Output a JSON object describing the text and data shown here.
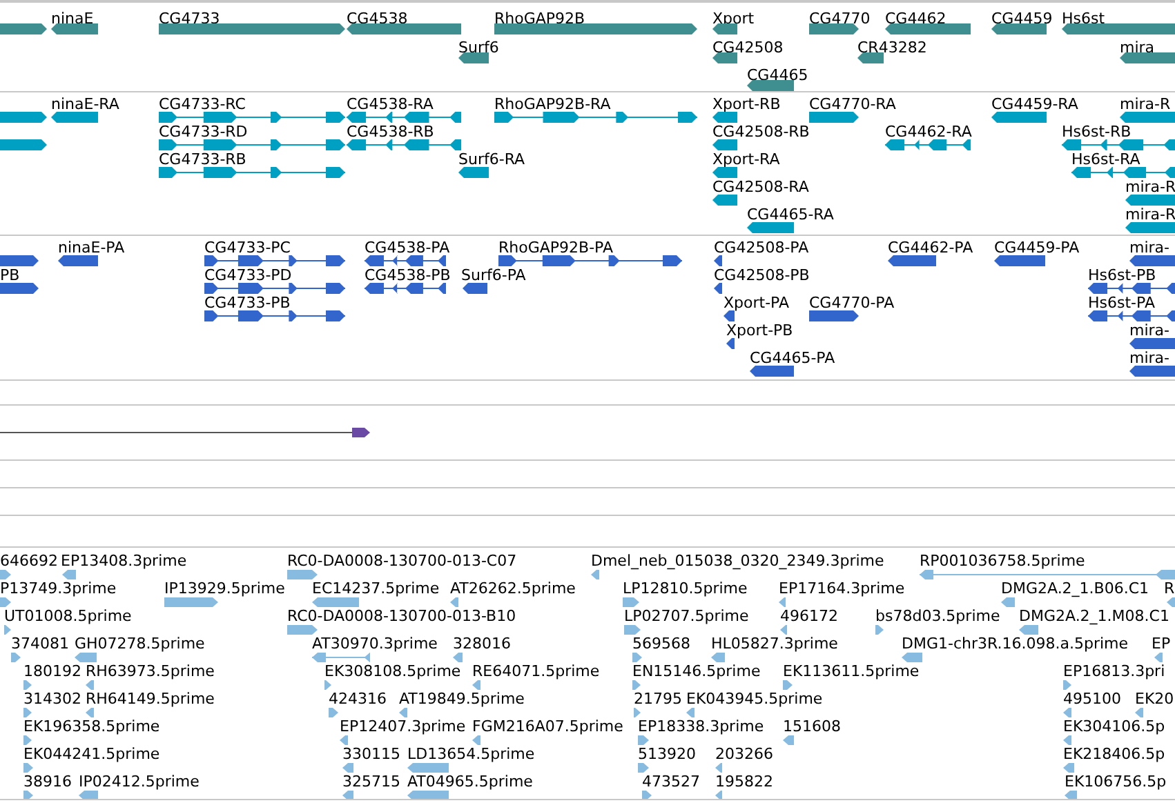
{
  "tracks": [
    {
      "kind": "gene",
      "features": [
        {
          "reverse": false
        },
        {
          "label": "ninaE",
          "reverse": true
        },
        {
          "label": "CG4733",
          "reverse": false
        },
        {
          "label": "CG4538",
          "reverse": true
        },
        {
          "label": "RhoGAP92B",
          "reverse": false
        },
        {
          "label": "Xport",
          "reverse": true
        },
        {
          "label": "CG4770",
          "reverse": false
        },
        {
          "label": "CG4462",
          "reverse": true
        },
        {
          "label": "CG4459",
          "reverse": true
        },
        {
          "label": "Hs6st",
          "reverse": true
        },
        {
          "label": "Surf6",
          "reverse": true
        },
        {
          "label": "CG42508",
          "reverse": true
        },
        {
          "label": "CR43282",
          "reverse": true
        },
        {
          "label": "mira",
          "reverse": true
        },
        {
          "label": "CG4465",
          "reverse": true
        }
      ]
    },
    {
      "kind": "transcript",
      "features": [
        {
          "reverse": false
        },
        {
          "label": "ninaE-RA",
          "reverse": true
        },
        {
          "label": "CG4733-RC",
          "reverse": false
        },
        {
          "label": "CG4538-RA",
          "reverse": true
        },
        {
          "label": "RhoGAP92B-RA",
          "reverse": false
        },
        {
          "label": "Xport-RB",
          "reverse": true
        },
        {
          "label": "CG4770-RA",
          "reverse": false
        },
        {
          "label": "CG4459-RA",
          "reverse": true
        },
        {
          "label": "mira-R",
          "reverse": true
        },
        {
          "reverse": false
        },
        {
          "label": "CG4733-RD",
          "reverse": false
        },
        {
          "label": "CG4538-RB",
          "reverse": true
        },
        {
          "label": "CG42508-RB",
          "reverse": true
        },
        {
          "label": "CG4462-RA",
          "reverse": true
        },
        {
          "label": "Hs6st-RB",
          "reverse": true
        },
        {
          "label": "CG4733-RB",
          "reverse": false
        },
        {
          "label": "Surf6-RA",
          "reverse": true
        },
        {
          "label": "Xport-RA",
          "reverse": true
        },
        {
          "label": "Hs6st-RA",
          "reverse": true
        },
        {
          "label": "CG42508-RA",
          "reverse": true
        },
        {
          "label": "mira-R",
          "reverse": true
        },
        {
          "label": "CG4465-RA",
          "reverse": true
        },
        {
          "label": "mira-R",
          "reverse": true
        }
      ]
    },
    {
      "kind": "protein",
      "features": [
        {
          "reverse": false
        },
        {
          "label": "ninaE-PA",
          "reverse": true
        },
        {
          "label": "CG4733-PC",
          "reverse": false
        },
        {
          "label": "CG4538-PA",
          "reverse": true
        },
        {
          "label": "RhoGAP92B-PA",
          "reverse": false
        },
        {
          "label": "CG42508-PA",
          "reverse": true
        },
        {
          "label": "CG4462-PA",
          "reverse": true
        },
        {
          "label": "CG4459-PA",
          "reverse": true
        },
        {
          "label": "mira-",
          "reverse": true
        },
        {
          "label": "PB",
          "reverse": false
        },
        {
          "label": "CG4733-PD",
          "reverse": false
        },
        {
          "label": "CG4538-PB",
          "reverse": true
        },
        {
          "label": "Surf6-PA",
          "reverse": true
        },
        {
          "label": "CG42508-PB",
          "reverse": true
        },
        {
          "label": "Hs6st-PB",
          "reverse": true
        },
        {
          "label": "CG4733-PB",
          "reverse": false
        },
        {
          "label": "Xport-PA",
          "reverse": true
        },
        {
          "label": "CG4770-PA",
          "reverse": false
        },
        {
          "label": "Hs6st-PA",
          "reverse": true
        },
        {
          "label": "Xport-PB",
          "reverse": true
        },
        {
          "label": "mira-",
          "reverse": true
        },
        {
          "label": "CG4465-PA",
          "reverse": true
        },
        {
          "label": "mira-",
          "reverse": true
        }
      ]
    },
    {
      "kind": "empty"
    },
    {
      "kind": "evidence",
      "features": [
        {
          "reverse": false
        }
      ]
    },
    {
      "kind": "empty"
    },
    {
      "kind": "empty"
    },
    {
      "kind": "empty"
    },
    {
      "kind": "est",
      "features": [
        {
          "label": "646692",
          "reverse": false
        },
        {
          "label": "EP13408.3prime",
          "reverse": true
        },
        {
          "label": "RC0-DA0008-130700-013-C07",
          "reverse": false
        },
        {
          "label": "Dmel_neb_015038_0320_2349.3prime",
          "reverse": true
        },
        {
          "label": "RP001036758.5prime",
          "reverse": true
        },
        {
          "label": "P13749.3prime",
          "reverse": false
        },
        {
          "label": "IP13929.5prime",
          "reverse": false
        },
        {
          "label": "EC14237.5prime",
          "reverse": true
        },
        {
          "label": "AT26262.5prime",
          "reverse": true
        },
        {
          "label": "LP12810.5prime",
          "reverse": false
        },
        {
          "label": "EP17164.3prime",
          "reverse": true
        },
        {
          "label": "DMG2A.2_1.B06.C1",
          "reverse": true
        },
        {
          "label": "R",
          "reverse": true
        },
        {
          "label": "UT01008.5prime",
          "reverse": false
        },
        {
          "label": "RC0-DA0008-130700-013-B10",
          "reverse": false
        },
        {
          "label": "LP02707.5prime",
          "reverse": false
        },
        {
          "label": "496172",
          "reverse": true
        },
        {
          "label": "bs78d03.5prime",
          "reverse": false
        },
        {
          "label": "DMG2A.2_1.M08.C1",
          "reverse": true
        },
        {
          "label": "374081",
          "reverse": false
        },
        {
          "label": "GH07278.5prime",
          "reverse": true
        },
        {
          "label": "AT30970.3prime",
          "reverse": true
        },
        {
          "label": "328016",
          "reverse": true
        },
        {
          "label": "569568",
          "reverse": false
        },
        {
          "label": "HL05827.3prime",
          "reverse": true
        },
        {
          "label": "DMG1-chr3R.16.098.a.5prime",
          "reverse": true
        },
        {
          "label": "EP",
          "reverse": true
        },
        {
          "label": "180192",
          "reverse": false
        },
        {
          "label": "RH63973.5prime",
          "reverse": true
        },
        {
          "label": "EK308108.5prime",
          "reverse": false
        },
        {
          "label": "RE64071.5prime",
          "reverse": true
        },
        {
          "label": "EN15146.5prime",
          "reverse": false
        },
        {
          "label": "EK113611.5prime",
          "reverse": false
        },
        {
          "label": "EP16813.3pri",
          "reverse": false
        },
        {
          "label": "314302",
          "reverse": false
        },
        {
          "label": "RH64149.5prime",
          "reverse": true
        },
        {
          "label": "424316",
          "reverse": false
        },
        {
          "label": "AT19849.5prime",
          "reverse": true
        },
        {
          "label": "21795",
          "reverse": false
        },
        {
          "label": "EK043945.5prime",
          "reverse": true
        },
        {
          "label": "495100",
          "reverse": true
        },
        {
          "label": "EK20",
          "reverse": true
        },
        {
          "label": "EK196358.5prime",
          "reverse": false
        },
        {
          "label": "EP12407.3prime",
          "reverse": true
        },
        {
          "label": "FGM216A07.5prime",
          "reverse": true
        },
        {
          "label": "EP18338.3prime",
          "reverse": false
        },
        {
          "label": "151608",
          "reverse": true
        },
        {
          "label": "EK304106.5p",
          "reverse": true
        },
        {
          "label": "EK044241.5prime",
          "reverse": false
        },
        {
          "label": "330115",
          "reverse": true
        },
        {
          "label": "LD13654.5prime",
          "reverse": true
        },
        {
          "label": "513920",
          "reverse": false
        },
        {
          "label": "203266",
          "reverse": true
        },
        {
          "label": "EK218406.5p",
          "reverse": true
        },
        {
          "label": "38916",
          "reverse": false
        },
        {
          "label": "IP02412.5prime",
          "reverse": true
        },
        {
          "label": "325715",
          "reverse": true
        },
        {
          "label": "AT04965.5prime",
          "reverse": true
        },
        {
          "label": "473527",
          "reverse": false
        },
        {
          "label": "195822",
          "reverse": true
        },
        {
          "label": "EK106756.5p",
          "reverse": true
        }
      ]
    }
  ]
}
